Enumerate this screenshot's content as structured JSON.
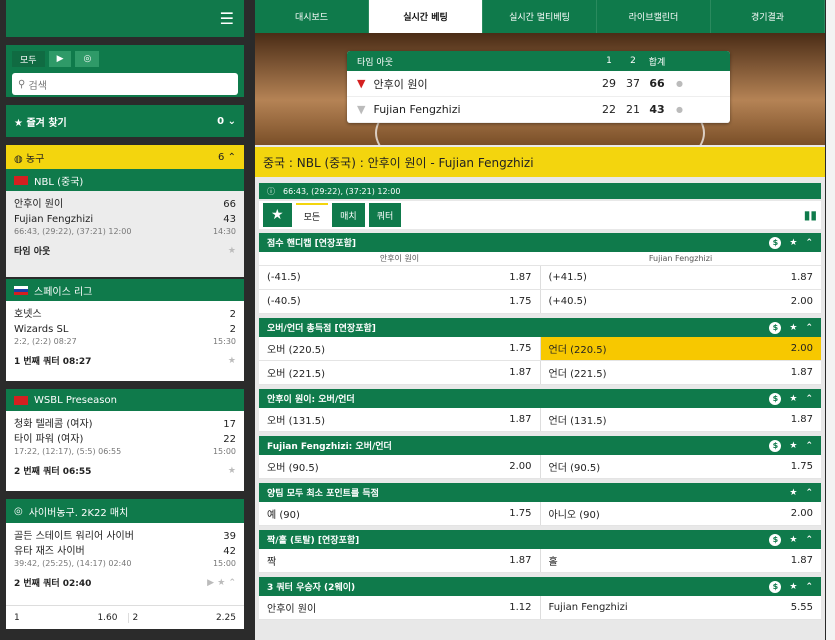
{
  "left": {
    "filters": [
      "모두"
    ],
    "search_placeholder": "검색",
    "fav_label": "즐겨 찾기",
    "fav_count": "0",
    "sport": "농구",
    "sport_count": "6",
    "leagues": [
      {
        "name": "NBL (중국)",
        "home": "안후이 원이",
        "home_score": "66",
        "away": "Fujian Fengzhizi",
        "away_score": "43",
        "detail": "66:43, (29:22), (37:21) 12:00",
        "time": "14:30",
        "status": "타임 아웃"
      },
      {
        "name": "스페이스 리그",
        "home": "호넷스",
        "home_score": "2",
        "away": "Wizards SL",
        "away_score": "2",
        "detail": "2:2, (2:2) 08:27",
        "time": "15:30",
        "status": "1 번째 쿼터 08:27"
      },
      {
        "name": "WSBL Preseason",
        "home": "청화 텔레콤 (여자)",
        "home_score": "17",
        "away": "타이 파워 (여자)",
        "away_score": "22",
        "detail": "17:22, (12:17), (5:5) 06:55",
        "time": "15:00",
        "status": "2 번째 쿼터 06:55"
      },
      {
        "name": "사이버농구. 2K22 매치",
        "home": "골든 스테이트 워리어 사이버",
        "home_score": "39",
        "away": "유타 재즈 사이버",
        "away_score": "42",
        "detail": "39:42, (25:25), (14:17) 02:40",
        "time": "15:00",
        "status": "2 번째 쿼터 02:40",
        "odds": [
          "1",
          "1.60",
          "2",
          "2.25"
        ]
      }
    ]
  },
  "tabs": [
    "대시보드",
    "실시간 베팅",
    "실시간 멀티베팅",
    "라이브캘린더",
    "경기결과"
  ],
  "score": {
    "head": "타임 아웃",
    "cols": [
      "1",
      "2",
      "합계"
    ],
    "rows": [
      {
        "team": "안후이 원이",
        "q1": "29",
        "q2": "37",
        "total": "66"
      },
      {
        "team": "Fujian Fengzhizi",
        "q1": "22",
        "q2": "21",
        "total": "43"
      }
    ]
  },
  "title": "중국 : NBL (중국) : 안후이 원이 - Fujian Fengzhizi",
  "info": "66:43, (29:22), (37:21) 12:00",
  "filters": [
    "모든",
    "매치",
    "쿼터"
  ],
  "markets": [
    {
      "name": "점수 핸디캡 [연장포함]",
      "cols": [
        "안후이 원이",
        "Fujian Fengzhizi"
      ],
      "rows": [
        [
          "(-41.5)",
          "1.87",
          "(+41.5)",
          "1.87"
        ],
        [
          "(-40.5)",
          "1.75",
          "(+40.5)",
          "2.00"
        ]
      ]
    },
    {
      "name": "오버/언더 총득점 [연장포함]",
      "rows": [
        [
          "오버 (220.5)",
          "1.75",
          "언더 (220.5)",
          "2.00"
        ],
        [
          "오버 (221.5)",
          "1.87",
          "언더 (221.5)",
          "1.87"
        ]
      ]
    },
    {
      "name": "안후이 원이: 오버/언더",
      "rows": [
        [
          "오버 (131.5)",
          "1.87",
          "언더 (131.5)",
          "1.87"
        ]
      ]
    },
    {
      "name": "Fujian Fengzhizi: 오버/언더",
      "rows": [
        [
          "오버 (90.5)",
          "2.00",
          "언더 (90.5)",
          "1.75"
        ]
      ]
    },
    {
      "name": "양팀 모두 최소 포인트를 득점",
      "rows": [
        [
          "예 (90)",
          "1.75",
          "아니오 (90)",
          "2.00"
        ]
      ]
    },
    {
      "name": "짝/홀 (토탈) [연장포함]",
      "rows": [
        [
          "짝",
          "1.87",
          "홀",
          "1.87"
        ]
      ]
    },
    {
      "name": "3 쿼터 우승자 (2웨이)",
      "rows": [
        [
          "안후이 원이",
          "1.12",
          "Fujian Fengzhizi",
          "5.55"
        ]
      ]
    }
  ]
}
